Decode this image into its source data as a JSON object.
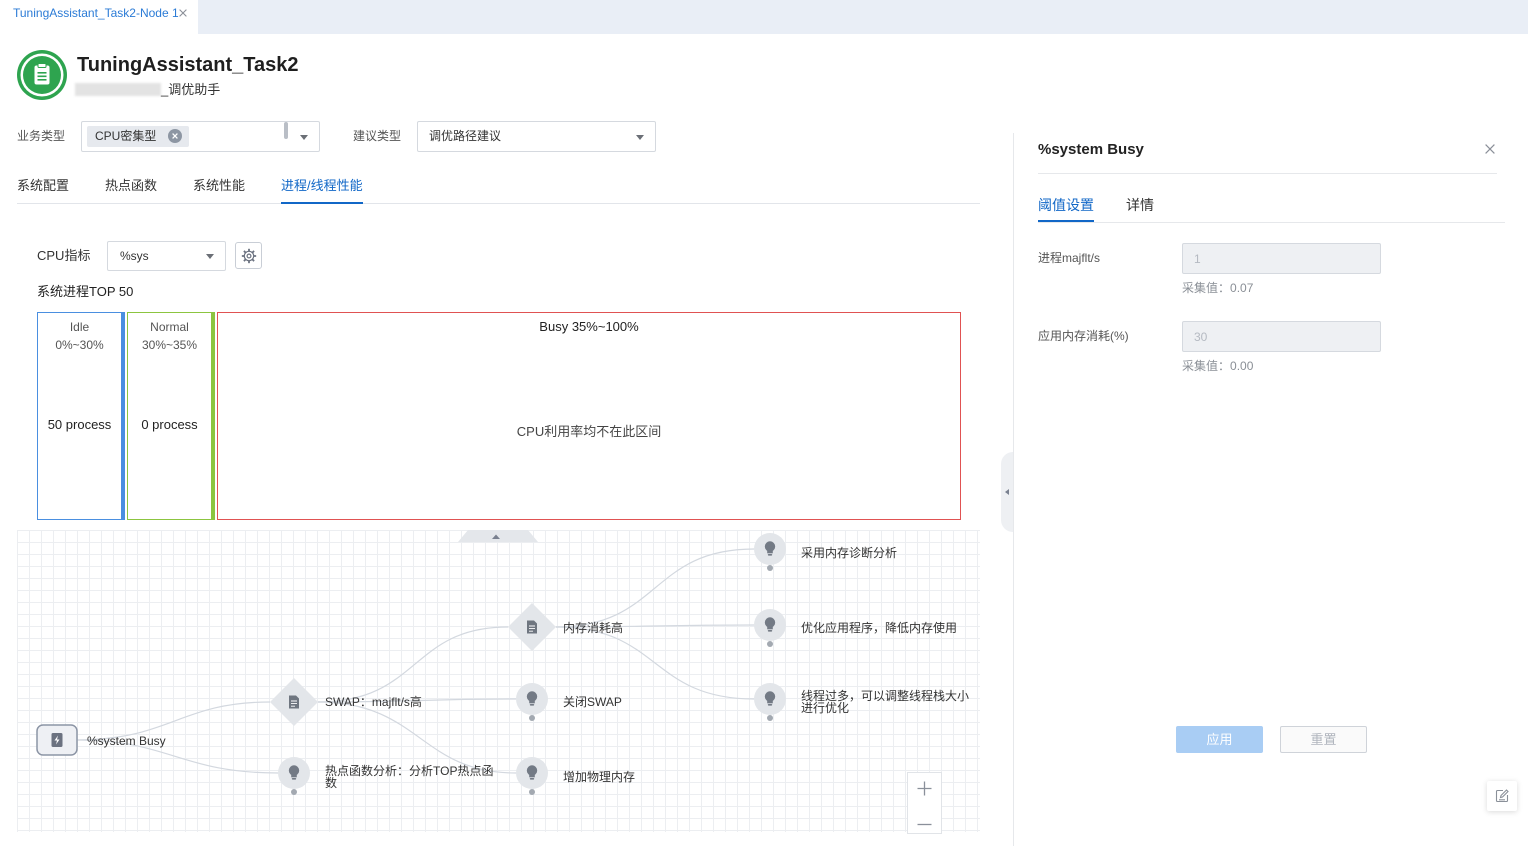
{
  "theme": {
    "accent": "#1167c7",
    "tab_text": "#2b7bd6",
    "idle": "#4a8fe0",
    "normal": "#8cc540",
    "busy": "#e05252",
    "logo": "#2ea44f",
    "apply_bg": "#a9cdf4"
  },
  "window_tab": {
    "label": "TuningAssistant_Task2-Node 1",
    "close_icon": "close-icon"
  },
  "header": {
    "logo_icon": "clipboard-icon",
    "title": "TuningAssistant_Task2",
    "subtitle": "_调优助手"
  },
  "filters": {
    "business_type": {
      "label": "业务类型",
      "selected": [
        "CPU密集型"
      ],
      "chip_remove_icon": "close-circle-icon"
    },
    "suggestion_type": {
      "label": "建议类型",
      "value": "调优路径建议"
    }
  },
  "tabs": [
    {
      "label": "系统配置",
      "active": false
    },
    {
      "label": "热点函数",
      "active": false
    },
    {
      "label": "系统性能",
      "active": false
    },
    {
      "label": "进程/线程性能",
      "active": true
    }
  ],
  "cpu_metric": {
    "label": "CPU指标",
    "value": "%sys",
    "settings_icon": "gear-icon"
  },
  "process_top": {
    "title": "系统进程TOP 50",
    "buckets": [
      {
        "name": "Idle",
        "range": "0%~30%",
        "count": "50 process"
      },
      {
        "name": "Normal",
        "range": "30%~35%",
        "count": "0 process"
      },
      {
        "name": "Busy",
        "range": "35%~100%",
        "message": "CPU利用率均不在此区间"
      }
    ]
  },
  "tuning_graph": {
    "nodes": [
      {
        "label": "%system Busy",
        "icon": "process-icon"
      },
      {
        "label": "SWAP：majflt/s高",
        "icon": "document-icon"
      },
      {
        "label": "热点函数分析：分析TOP热点函数",
        "icon": "lightbulb-icon"
      },
      {
        "label": "内存消耗高",
        "icon": "document-icon"
      },
      {
        "label": "关闭SWAP",
        "icon": "lightbulb-icon"
      },
      {
        "label": "增加物理内存",
        "icon": "lightbulb-icon"
      },
      {
        "label": "采用内存诊断分析",
        "icon": "lightbulb-icon"
      },
      {
        "label": "优化应用程序，降低内存使用",
        "icon": "lightbulb-icon"
      },
      {
        "label": "线程过多，可以调整线程栈大小进行优化",
        "icon": "lightbulb-icon"
      }
    ],
    "zoom_in_icon": "plus-icon",
    "zoom_out_icon": "minus-icon"
  },
  "detail_panel": {
    "title": "%system Busy",
    "close_icon": "close-icon",
    "tabs": [
      {
        "label": "阈值设置",
        "active": true
      },
      {
        "label": "详情",
        "active": false
      }
    ],
    "fields": [
      {
        "label": "进程majflt/s",
        "value": "1",
        "collected_label": "采集值：",
        "collected_value": "0.07"
      },
      {
        "label": "应用内存消耗(%)",
        "value": "30",
        "collected_label": "采集值：",
        "collected_value": "0.00"
      }
    ],
    "apply_label": "应用",
    "reset_label": "重置"
  },
  "floating_action": {
    "icon": "edit-icon"
  }
}
